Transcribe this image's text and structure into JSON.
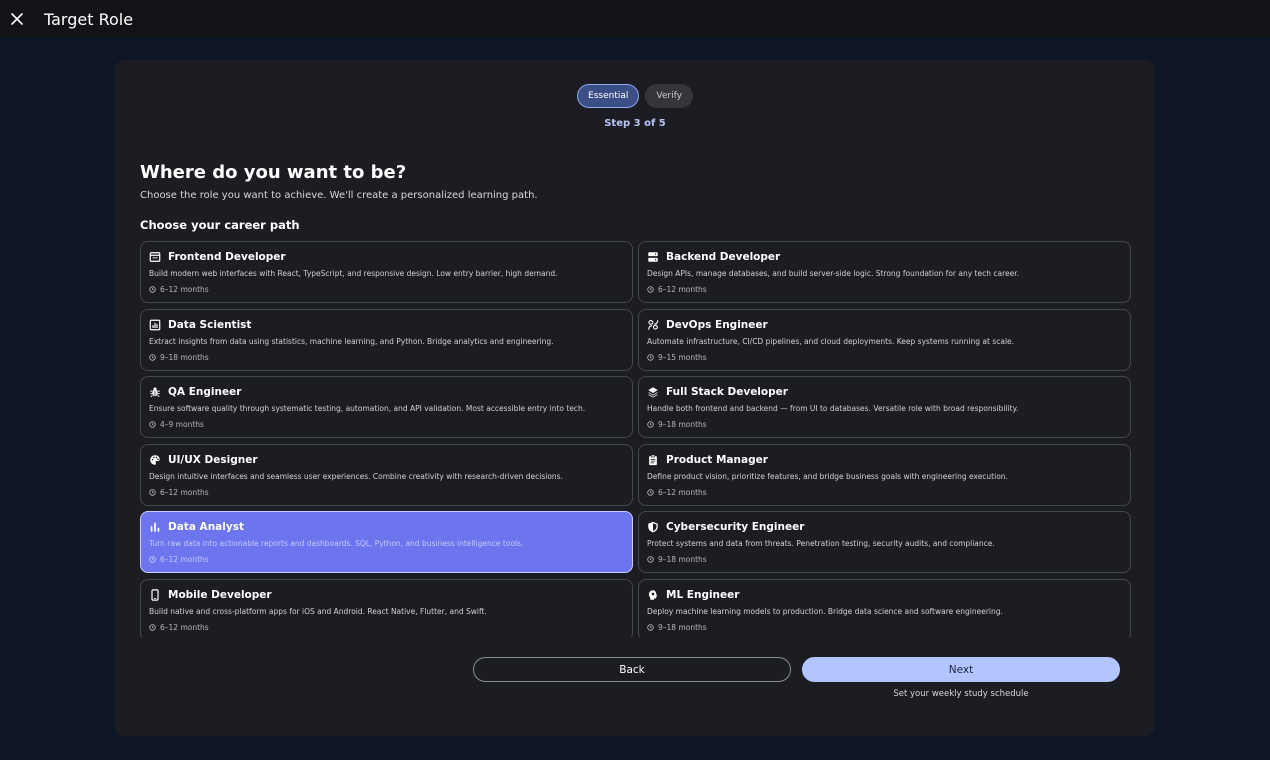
{
  "header": {
    "title": "Target Role",
    "close_icon": "close-icon"
  },
  "stepper": {
    "steps": [
      {
        "label": "Essential",
        "active": true
      },
      {
        "label": "Verify",
        "active": false
      }
    ],
    "step_text": "Step 3 of 5"
  },
  "main": {
    "heading": "Where do you want to be?",
    "subheading": "Choose the role you want to achieve. We'll create a personalized learning path.",
    "section_title": "Choose your career path"
  },
  "roles": [
    {
      "title": "Frontend Developer",
      "icon": "web-icon",
      "description": "Build modern web interfaces with React, TypeScript, and responsive design. Low entry barrier, high demand.",
      "duration": "6–12 months",
      "selected": false
    },
    {
      "title": "Backend Developer",
      "icon": "server-icon",
      "description": "Design APIs, manage databases, and build server-side logic. Strong foundation for any tech career.",
      "duration": "6–12 months",
      "selected": false
    },
    {
      "title": "Data Scientist",
      "icon": "analytics-icon",
      "description": "Extract insights from data using statistics, machine learning, and Python. Bridge analytics and engineering.",
      "duration": "9–18 months",
      "selected": false
    },
    {
      "title": "DevOps Engineer",
      "icon": "devops-icon",
      "description": "Automate infrastructure, CI/CD pipelines, and cloud deployments. Keep systems running at scale.",
      "duration": "9–15 months",
      "selected": false
    },
    {
      "title": "QA Engineer",
      "icon": "bug-icon",
      "description": "Ensure software quality through systematic testing, automation, and API validation. Most accessible entry into tech.",
      "duration": "4–9 months",
      "selected": false
    },
    {
      "title": "Full Stack Developer",
      "icon": "layers-icon",
      "description": "Handle both frontend and backend — from UI to databases. Versatile role with broad responsibility.",
      "duration": "9–18 months",
      "selected": false
    },
    {
      "title": "UI/UX Designer",
      "icon": "palette-icon",
      "description": "Design intuitive interfaces and seamless user experiences. Combine creativity with research-driven decisions.",
      "duration": "6–12 months",
      "selected": false
    },
    {
      "title": "Product Manager",
      "icon": "clipboard-icon",
      "description": "Define product vision, prioritize features, and bridge business goals with engineering execution.",
      "duration": "6–12 months",
      "selected": false
    },
    {
      "title": "Data Analyst",
      "icon": "bar-chart-icon",
      "description": "Turn raw data into actionable reports and dashboards. SQL, Python, and business intelligence tools.",
      "duration": "6–12 months",
      "selected": true
    },
    {
      "title": "Cybersecurity Engineer",
      "icon": "shield-icon",
      "description": "Protect systems and data from threats. Penetration testing, security audits, and compliance.",
      "duration": "9–18 months",
      "selected": false
    },
    {
      "title": "Mobile Developer",
      "icon": "smartphone-icon",
      "description": "Build native and cross-platform apps for iOS and Android. React Native, Flutter, and Swift.",
      "duration": "6–12 months",
      "selected": false
    },
    {
      "title": "ML Engineer",
      "icon": "psychology-icon",
      "description": "Deploy machine learning models to production. Bridge data science and software engineering.",
      "duration": "9–18 months",
      "selected": false
    }
  ],
  "footer": {
    "back_label": "Back",
    "next_label": "Next",
    "next_hint": "Set your weekly study schedule"
  },
  "colors": {
    "page_bg": "#0e1524",
    "card_bg": "#1c1d22",
    "selected_card": "#6c74ee",
    "accent": "#b2c5ff"
  }
}
